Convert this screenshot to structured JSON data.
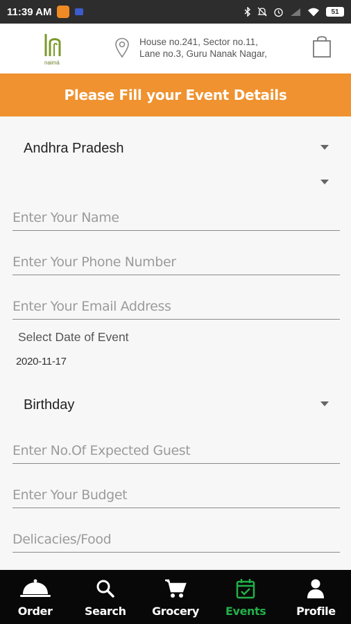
{
  "status_bar": {
    "time": "11:39 AM",
    "battery": "51",
    "icons": [
      "bluetooth-icon",
      "mute-icon",
      "alarm-icon",
      "signal-icon",
      "wifi-icon",
      "battery-icon"
    ]
  },
  "header": {
    "logo_text": "naimä",
    "address_line1": "House no.241, Sector no.11,",
    "address_line2": "Lane no.3, Guru Nanak Nagar,",
    "icons": [
      "location-pin-icon",
      "shopping-bag-icon"
    ]
  },
  "banner": {
    "title": "Please Fill your Event Details"
  },
  "form": {
    "state_select": {
      "value": "Andhra Pradesh"
    },
    "city_select": {
      "value": ""
    },
    "name_field": {
      "value": "",
      "placeholder": "Enter Your Name"
    },
    "phone_field": {
      "value": "",
      "placeholder": "Enter Your Phone Number"
    },
    "email_field": {
      "value": "",
      "placeholder": "Enter Your Email Address"
    },
    "date_label": "Select Date of Event",
    "date_value": "2020-11-17",
    "event_type_select": {
      "value": "Birthday"
    },
    "guests_field": {
      "value": "",
      "placeholder": "Enter No.Of Expected Guest"
    },
    "budget_field": {
      "value": "",
      "placeholder": "Enter Your Budget"
    },
    "food_field": {
      "value": "",
      "placeholder": "Delicacies/Food"
    }
  },
  "bottom_nav": {
    "items": [
      {
        "label": "Order",
        "icon": "cloche-icon",
        "active": false
      },
      {
        "label": "Search",
        "icon": "search-icon",
        "active": false
      },
      {
        "label": "Grocery",
        "icon": "cart-icon",
        "active": false
      },
      {
        "label": "Events",
        "icon": "calendar-check-icon",
        "active": true
      },
      {
        "label": "Profile",
        "icon": "person-icon",
        "active": false
      }
    ],
    "active_color": "#22b04a"
  },
  "colors": {
    "banner": "#ef922f",
    "status_bar": "#2d2d2d",
    "nav_background": "#080808"
  }
}
